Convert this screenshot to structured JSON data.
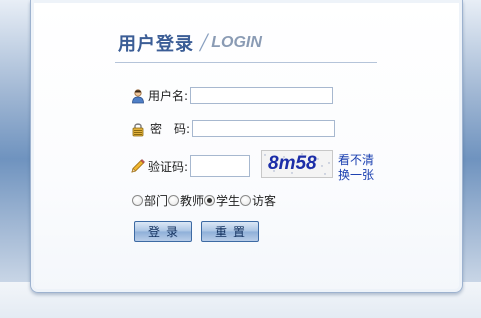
{
  "header": {
    "title_cn": "用户登录",
    "title_slash": "/",
    "title_en": "LOGIN"
  },
  "form": {
    "username": {
      "label": "用户名:",
      "value": ""
    },
    "password": {
      "label": "密　码:",
      "value": ""
    },
    "captcha": {
      "label": "验证码:",
      "value": "",
      "image_text": "8m58",
      "refresh_line1": "看不清",
      "refresh_line2": "换一张"
    }
  },
  "roles": {
    "options": [
      "部门",
      "教师",
      "学生",
      "访客"
    ],
    "selected": "学生"
  },
  "buttons": {
    "login": "登录",
    "reset": "重置"
  },
  "icons": {
    "username": "user-icon",
    "password": "lock-icon",
    "captcha": "pencil-icon"
  }
}
